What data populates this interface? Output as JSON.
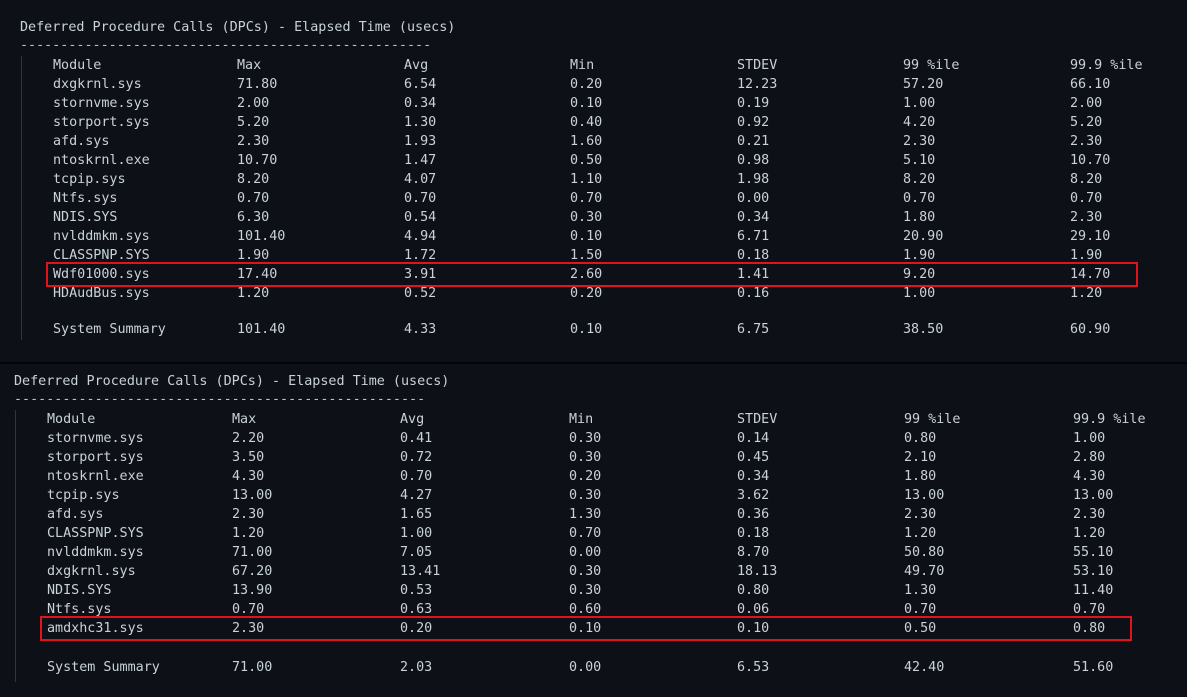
{
  "panels": [
    {
      "title": "Deferred Procedure Calls (DPCs) - Elapsed Time (usecs)",
      "rule": "---------------------------------------------------",
      "columns": [
        "Module",
        "Max",
        "Avg",
        "Min",
        "STDEV",
        "99 %ile",
        "99.9 %ile"
      ],
      "rows": [
        [
          "dxgkrnl.sys",
          "71.80",
          "6.54",
          "0.20",
          "12.23",
          "57.20",
          "66.10"
        ],
        [
          "stornvme.sys",
          "2.00",
          "0.34",
          "0.10",
          "0.19",
          "1.00",
          "2.00"
        ],
        [
          "storport.sys",
          "5.20",
          "1.30",
          "0.40",
          "0.92",
          "4.20",
          "5.20"
        ],
        [
          "afd.sys",
          "2.30",
          "1.93",
          "1.60",
          "0.21",
          "2.30",
          "2.30"
        ],
        [
          "ntoskrnl.exe",
          "10.70",
          "1.47",
          "0.50",
          "0.98",
          "5.10",
          "10.70"
        ],
        [
          "tcpip.sys",
          "8.20",
          "4.07",
          "1.10",
          "1.98",
          "8.20",
          "8.20"
        ],
        [
          "Ntfs.sys",
          "0.70",
          "0.70",
          "0.70",
          "0.00",
          "0.70",
          "0.70"
        ],
        [
          "NDIS.SYS",
          "6.30",
          "0.54",
          "0.30",
          "0.34",
          "1.80",
          "2.30"
        ],
        [
          "nvlddmkm.sys",
          "101.40",
          "4.94",
          "0.10",
          "6.71",
          "20.90",
          "29.10"
        ],
        [
          "CLASSPNP.SYS",
          "1.90",
          "1.72",
          "1.50",
          "0.18",
          "1.90",
          "1.90"
        ],
        [
          "Wdf01000.sys",
          "17.40",
          "3.91",
          "2.60",
          "1.41",
          "9.20",
          "14.70"
        ],
        [
          "HDAudBus.sys",
          "1.20",
          "0.52",
          "0.20",
          "0.16",
          "1.00",
          "1.20"
        ]
      ],
      "highlighted_row": 10,
      "summary": [
        "System Summary",
        "101.40",
        "4.33",
        "0.10",
        "6.75",
        "38.50",
        "60.90"
      ]
    },
    {
      "title": "Deferred Procedure Calls (DPCs) - Elapsed Time (usecs)",
      "rule": "---------------------------------------------------",
      "columns": [
        "Module",
        "Max",
        "Avg",
        "Min",
        "STDEV",
        "99 %ile",
        "99.9 %ile"
      ],
      "rows": [
        [
          "stornvme.sys",
          "2.20",
          "0.41",
          "0.30",
          "0.14",
          "0.80",
          "1.00"
        ],
        [
          "storport.sys",
          "3.50",
          "0.72",
          "0.30",
          "0.45",
          "2.10",
          "2.80"
        ],
        [
          "ntoskrnl.exe",
          "4.30",
          "0.70",
          "0.20",
          "0.34",
          "1.80",
          "4.30"
        ],
        [
          "tcpip.sys",
          "13.00",
          "4.27",
          "0.30",
          "3.62",
          "13.00",
          "13.00"
        ],
        [
          "afd.sys",
          "2.30",
          "1.65",
          "1.30",
          "0.36",
          "2.30",
          "2.30"
        ],
        [
          "CLASSPNP.SYS",
          "1.20",
          "1.00",
          "0.70",
          "0.18",
          "1.20",
          "1.20"
        ],
        [
          "nvlddmkm.sys",
          "71.00",
          "7.05",
          "0.00",
          "8.70",
          "50.80",
          "55.10"
        ],
        [
          "dxgkrnl.sys",
          "67.20",
          "13.41",
          "0.30",
          "18.13",
          "49.70",
          "53.10"
        ],
        [
          "NDIS.SYS",
          "13.90",
          "0.53",
          "0.30",
          "0.80",
          "1.30",
          "11.40"
        ],
        [
          "Ntfs.sys",
          "0.70",
          "0.63",
          "0.60",
          "0.06",
          "0.70",
          "0.70"
        ],
        [
          "amdxhc31.sys",
          "2.30",
          "0.20",
          "0.10",
          "0.10",
          "0.50",
          "0.80"
        ]
      ],
      "highlighted_row": 10,
      "summary": [
        "System Summary",
        "71.00",
        "2.03",
        "0.00",
        "6.53",
        "42.40",
        "51.60"
      ]
    }
  ],
  "colors": {
    "background": "#0d1117",
    "text": "#c9d1d9",
    "highlight_border": "#e0141b"
  }
}
